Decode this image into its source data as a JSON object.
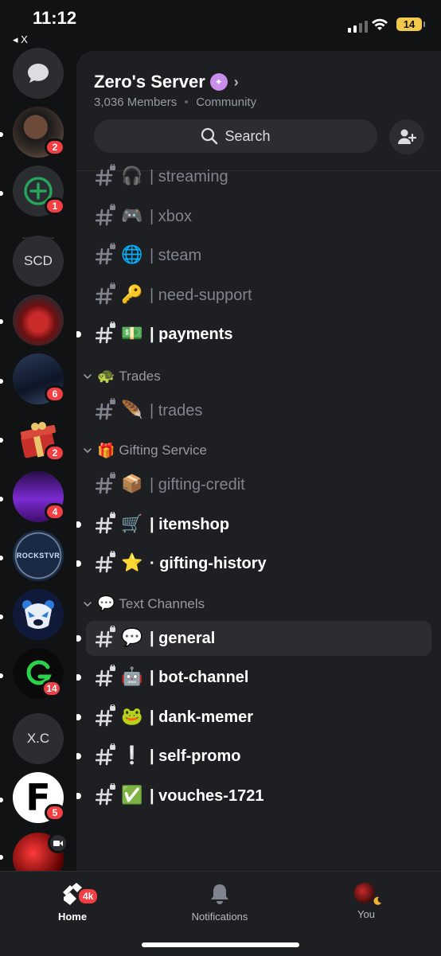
{
  "status_bar": {
    "time": "11:12",
    "back_label": "◂ X",
    "battery": "14"
  },
  "server": {
    "name": "Zero's Server",
    "members": "3,036 Members",
    "type": "Community",
    "search_label": "Search"
  },
  "rail": {
    "items": [
      {
        "kind": "dm",
        "badge": ""
      },
      {
        "kind": "avatar",
        "badge": "2"
      },
      {
        "kind": "add",
        "badge": "1"
      },
      {
        "kind": "text",
        "label": "SCD",
        "badge": ""
      },
      {
        "kind": "img",
        "badge": ""
      },
      {
        "kind": "img",
        "badge": "6"
      },
      {
        "kind": "gift",
        "badge": "2"
      },
      {
        "kind": "img",
        "badge": "4"
      },
      {
        "kind": "img",
        "label": "ROCKSTVR",
        "badge": ""
      },
      {
        "kind": "bear",
        "badge": ""
      },
      {
        "kind": "img",
        "badge": "14"
      },
      {
        "kind": "text",
        "label": "X.C",
        "badge": ""
      },
      {
        "kind": "f",
        "label": "F",
        "badge": "5"
      },
      {
        "kind": "img",
        "badge": ""
      }
    ]
  },
  "channels": [
    {
      "emoji": "🎧",
      "name": "| streaming",
      "unread": false
    },
    {
      "emoji": "🎮",
      "name": "| xbox",
      "unread": false
    },
    {
      "emoji": "🌐",
      "name": "| steam",
      "unread": false
    },
    {
      "emoji": "🔑",
      "name": "| need-support",
      "unread": false
    },
    {
      "emoji": "💵",
      "name": "| payments",
      "unread": true
    }
  ],
  "categories": [
    {
      "emoji": "🐢",
      "name": "Trades",
      "channels": [
        {
          "emoji": "🪶",
          "name": "| trades",
          "unread": false
        }
      ]
    },
    {
      "emoji": "🎁",
      "name": "Gifting Service",
      "channels": [
        {
          "emoji": "📦",
          "name": "| gifting-credit",
          "unread": false
        },
        {
          "emoji": "🛒",
          "name": "| itemshop",
          "unread": true
        },
        {
          "emoji": "⭐",
          "name": "· gifting-history",
          "unread": true
        }
      ]
    },
    {
      "emoji": "💬",
      "name": "Text Channels",
      "channels": [
        {
          "emoji": "💬",
          "name": "| general",
          "unread": true,
          "selected": true
        },
        {
          "emoji": "🤖",
          "name": "| bot-channel",
          "unread": true
        },
        {
          "emoji": "🐸",
          "name": "| dank-memer",
          "unread": true
        },
        {
          "emoji": "❕",
          "name": "| self-promo",
          "unread": true
        },
        {
          "emoji": "✅",
          "name": "| vouches-1721",
          "unread": true
        }
      ]
    }
  ],
  "nav": {
    "home": "Home",
    "home_badge": "4k",
    "notifications": "Notifications",
    "you": "You"
  },
  "colors": {
    "accent": "#5865f2",
    "badge": "#f23f43",
    "bg": "#1e1f22",
    "rail": "#111214"
  }
}
